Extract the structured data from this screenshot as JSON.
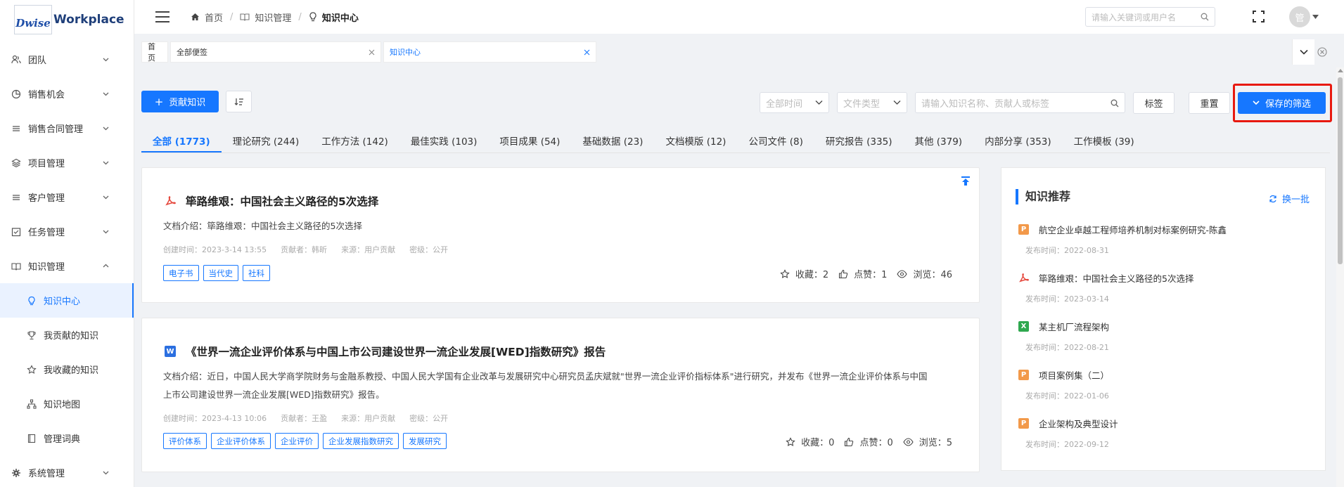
{
  "app": {
    "logo_brand": "Dwise",
    "logo_name": "Workplace"
  },
  "sidebar": {
    "items": [
      {
        "label": "团队",
        "icon": "team-icon"
      },
      {
        "label": "销售机会",
        "icon": "pie-chart-icon"
      },
      {
        "label": "销售合同管理",
        "icon": "list-icon"
      },
      {
        "label": "项目管理",
        "icon": "layers-icon"
      },
      {
        "label": "客户管理",
        "icon": "list-icon"
      },
      {
        "label": "任务管理",
        "icon": "checkbox-icon"
      },
      {
        "label": "知识管理",
        "icon": "book-icon"
      }
    ],
    "sub_items": [
      {
        "label": "知识中心",
        "icon": "lightbulb-icon",
        "active": true
      },
      {
        "label": "我贡献的知识",
        "icon": "trophy-icon"
      },
      {
        "label": "我收藏的知识",
        "icon": "star-icon"
      },
      {
        "label": "知识地图",
        "icon": "sitemap-icon"
      },
      {
        "label": "管理词典",
        "icon": "dictionary-icon"
      }
    ],
    "last_item": {
      "label": "系统管理",
      "icon": "gear-icon"
    }
  },
  "header": {
    "breadcrumb": [
      "首页",
      "知识管理",
      "知识中心"
    ],
    "search_placeholder": "请输入关键词或用户名",
    "avatar_text": "管"
  },
  "page_tabs": [
    {
      "label": "首页"
    },
    {
      "label": "全部便签"
    },
    {
      "label": "知识中心"
    }
  ],
  "toolbar": {
    "contribute_label": "贡献知识",
    "time_select": "全部时间",
    "type_select": "文件类型",
    "search_placeholder": "请输入知识名称、贡献人或标签",
    "tag_label": "标签",
    "reset_label": "重置",
    "saved_filter_label": "保存的筛选"
  },
  "categories": [
    {
      "label": "全部 (1773)"
    },
    {
      "label": "理论研究 (244)"
    },
    {
      "label": "工作方法 (142)"
    },
    {
      "label": "最佳实践 (103)"
    },
    {
      "label": "项目成果 (54)"
    },
    {
      "label": "基础数据 (23)"
    },
    {
      "label": "文档模版 (12)"
    },
    {
      "label": "公司文件 (8)"
    },
    {
      "label": "研究报告 (335)"
    },
    {
      "label": "其他 (379)"
    },
    {
      "label": "内部分享 (353)"
    },
    {
      "label": "工作模板 (39)"
    }
  ],
  "cards": [
    {
      "type": "pdf",
      "title": "筚路维艰：中国社会主义路径的5次选择",
      "desc1": "文档介绍：筚路维艰：中国社会主义路径的5次选择",
      "desc2": "",
      "created": "创建时间：2023-3-14 13:55",
      "contributor": "贡献者：韩昕",
      "source": "来源：用户贡献",
      "security": "密级：公开",
      "tags": [
        "电子书",
        "当代史",
        "社科"
      ],
      "fav": "收藏：2",
      "like": "点赞：1",
      "view": "浏览：46"
    },
    {
      "type": "word",
      "title": "《世界一流企业评价体系与中国上市公司建设世界一流企业发展[WED]指数研究》报告",
      "desc1": "文档介绍：近日，中国人民大学商学院财务与金融系教授、中国人民大学国有企业改革与发展研究中心研究员孟庆斌就\"世界一流企业评价指标体系\"进行研究，并发布《世界一流企业评价体系与中国",
      "desc2": "上市公司建设世界一流企业发展[WED]指数研究》报告。",
      "created": "创建时间：2023-4-13 10:06",
      "contributor": "贡献者：王盈",
      "source": "来源：用户贡献",
      "security": "密级：公开",
      "tags": [
        "评价体系",
        "企业评价体系",
        "企业评价",
        "企业发展指数研究",
        "发展研究"
      ],
      "fav": "收藏：0",
      "like": "点赞：0",
      "view": "浏览：5"
    }
  ],
  "recommend": {
    "title": "知识推荐",
    "refresh": "换一批",
    "items": [
      {
        "type": "ppt",
        "badge": "P",
        "name": "航空企业卓越工程师培养机制对标案例研究-陈鑫",
        "date": "发布时间：2022-08-31"
      },
      {
        "type": "pdf",
        "badge": "",
        "name": "筚路维艰：中国社会主义路径的5次选择",
        "date": "发布时间：2023-03-14"
      },
      {
        "type": "excel",
        "badge": "X",
        "name": "某主机厂流程架构",
        "date": "发布时间：2022-08-21"
      },
      {
        "type": "ppt",
        "badge": "P",
        "name": "项目案例集（二）",
        "date": "发布时间：2022-01-06"
      },
      {
        "type": "ppt",
        "badge": "P",
        "name": "企业架构及典型设计",
        "date": "发布时间：2022-09-12"
      }
    ]
  },
  "colors": {
    "primary": "#1677ff",
    "pdf": "#e5483d",
    "word": "#2b6fe0",
    "excel": "#2fa84f",
    "ppt": "#f2994a",
    "highlight": "#e8190f"
  }
}
